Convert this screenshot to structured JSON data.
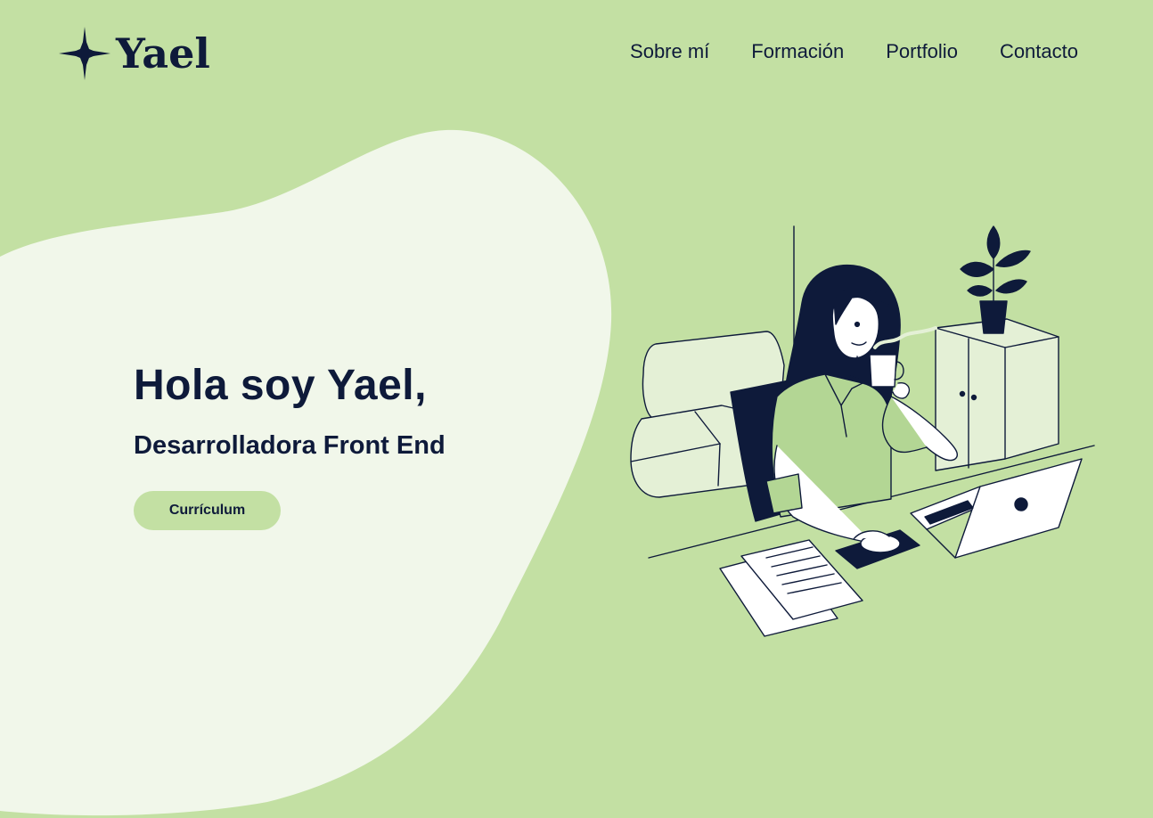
{
  "brand": {
    "name": "Yael",
    "logo_icon": "four-point-star-icon"
  },
  "nav": {
    "items": [
      {
        "label": "Sobre mí"
      },
      {
        "label": "Formación"
      },
      {
        "label": "Portfolio"
      },
      {
        "label": "Contacto"
      }
    ]
  },
  "hero": {
    "greeting": "Hola soy Yael,",
    "role": "Desarrolladora Front End",
    "cv_button_label": "Currículum"
  },
  "illustration": {
    "subject": "woman-working-at-desk-illustration"
  },
  "colors": {
    "background": "#c3e0a3",
    "blob": "#f1f7ea",
    "text": "#0e1a3a",
    "button": "#c3e0a3"
  }
}
